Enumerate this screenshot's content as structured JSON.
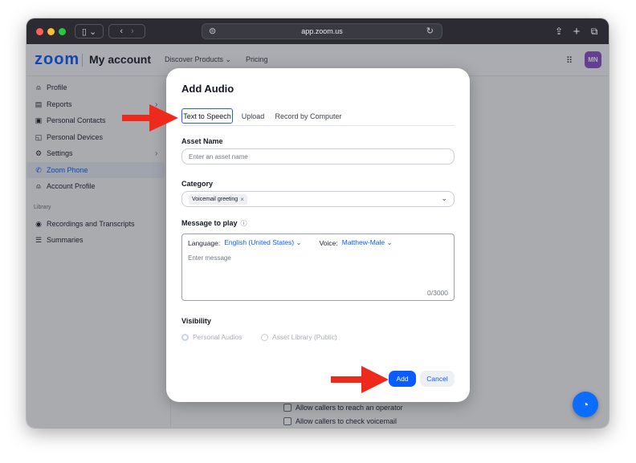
{
  "browser": {
    "url": "app.zoom.us",
    "icons": [
      "sidebar-toggle-icon",
      "back-icon",
      "forward-icon",
      "site-settings-icon",
      "reload-icon",
      "share-icon",
      "new-tab-icon",
      "tabs-overview-icon"
    ]
  },
  "header": {
    "logo": "zoom",
    "title": "My account",
    "nav": [
      "Discover Products",
      "Pricing"
    ],
    "avatar_initials": "MN"
  },
  "sidebar": {
    "items": [
      {
        "label": "Profile",
        "icon": "person-icon"
      },
      {
        "label": "Reports",
        "icon": "report-icon"
      },
      {
        "label": "Personal Contacts",
        "icon": "contacts-icon"
      },
      {
        "label": "Personal Devices",
        "icon": "devices-icon"
      },
      {
        "label": "Settings",
        "icon": "gear-icon"
      },
      {
        "label": "Zoom Phone",
        "icon": "phone-icon"
      },
      {
        "label": "Account Profile",
        "icon": "account-icon"
      }
    ],
    "section_label": "Library",
    "library_items": [
      {
        "label": "Recordings and Transcripts",
        "icon": "record-icon"
      },
      {
        "label": "Summaries",
        "icon": "summary-icon"
      }
    ]
  },
  "main": {
    "options": [
      "Allow callers to reach an operator",
      "Allow callers to check voicemail"
    ]
  },
  "modal": {
    "title": "Add Audio",
    "tabs": [
      "Text to Speech",
      "Upload",
      "Record by Computer"
    ],
    "asset_name_label": "Asset Name",
    "asset_name_placeholder": "Enter an asset name",
    "category_label": "Category",
    "category_value": "Voicemail greeting",
    "message_label": "Message to play",
    "language_label": "Language:",
    "language_value": "English (United States)",
    "voice_label": "Voice:",
    "voice_value": "Matthew-Male",
    "message_placeholder": "Enter message",
    "char_count": "0/3000",
    "visibility_label": "Visibility",
    "visibility_options": [
      "Personal Audios",
      "Asset Library (Public)"
    ],
    "add_label": "Add",
    "cancel_label": "Cancel"
  },
  "colors": {
    "accent": "#0b5cff",
    "annotation_arrow": "#ee2a1d",
    "avatar": "#8c4ec9"
  }
}
